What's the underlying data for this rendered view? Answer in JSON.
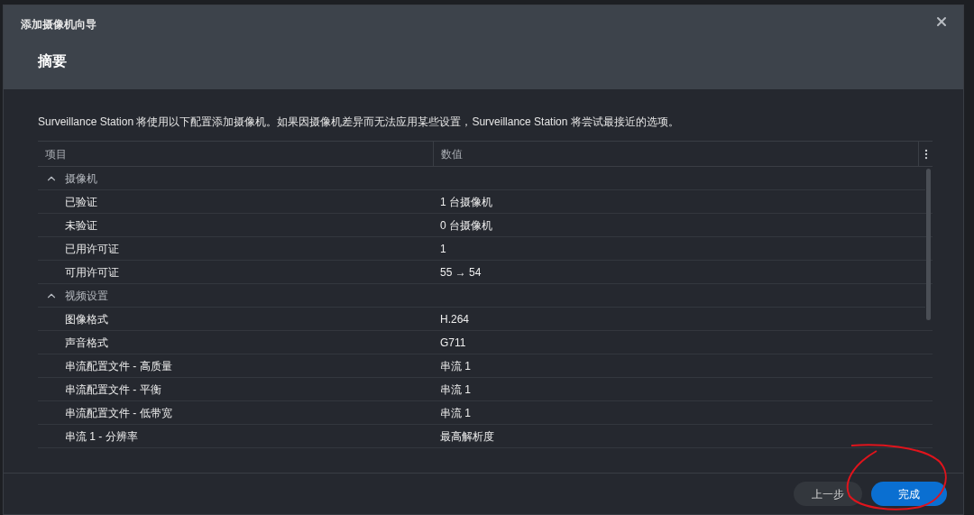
{
  "window": {
    "title": "添加摄像机向导"
  },
  "page_title": "摘要",
  "description": "Surveillance Station 将使用以下配置添加摄像机。如果因摄像机差异而无法应用某些设置，Surveillance Station 将尝试最接近的选项。",
  "table": {
    "columns": [
      "项目",
      "数值"
    ],
    "groups": [
      {
        "label": "摄像机",
        "expanded": true,
        "rows": [
          {
            "item": "已验证",
            "value": "1 台摄像机"
          },
          {
            "item": "未验证",
            "value": "0 台摄像机"
          },
          {
            "item": "已用许可证",
            "value": "1"
          },
          {
            "item": "可用许可证",
            "value": "55 → 54"
          }
        ]
      },
      {
        "label": "视频设置",
        "expanded": true,
        "rows": [
          {
            "item": "图像格式",
            "value": "H.264"
          },
          {
            "item": "声音格式",
            "value": "G711"
          },
          {
            "item": "串流配置文件 - 高质量",
            "value": "串流 1"
          },
          {
            "item": "串流配置文件 - 平衡",
            "value": "串流 1"
          },
          {
            "item": "串流配置文件 - 低带宽",
            "value": "串流 1"
          },
          {
            "item": "串流 1 - 分辨率",
            "value": "最高解析度"
          }
        ]
      }
    ]
  },
  "buttons": [
    {
      "label": "上一步",
      "kind": "secondary"
    },
    {
      "label": "完成",
      "kind": "primary"
    }
  ]
}
